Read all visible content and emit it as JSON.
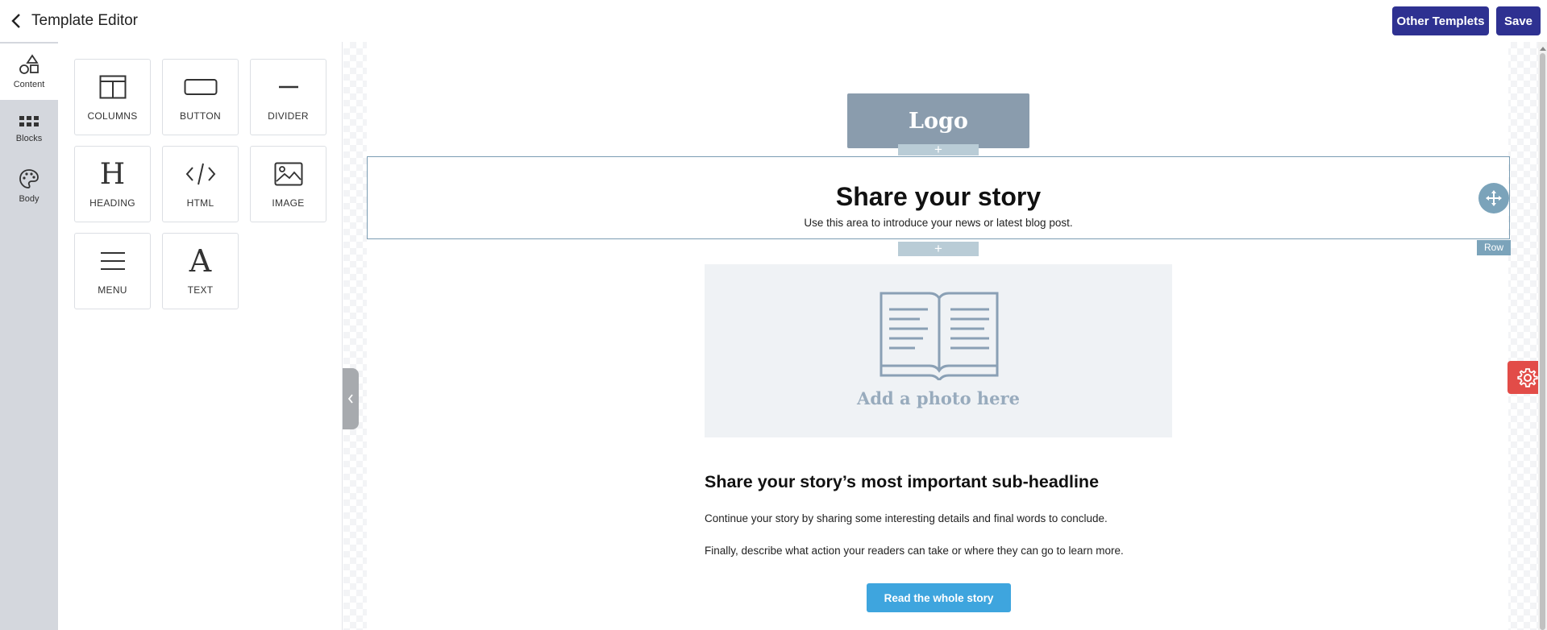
{
  "header": {
    "title": "Template Editor",
    "other_templates_label": "Other Templets",
    "save_label": "Save"
  },
  "rail": {
    "items": [
      {
        "label": "Content",
        "icon": "shapes-icon",
        "active": true
      },
      {
        "label": "Blocks",
        "icon": "grid-icon",
        "active": false
      },
      {
        "label": "Body",
        "icon": "palette-icon",
        "active": false
      }
    ]
  },
  "palette": {
    "tiles": [
      {
        "label": "COLUMNS",
        "icon": "columns-icon"
      },
      {
        "label": "BUTTON",
        "icon": "button-icon"
      },
      {
        "label": "DIVIDER",
        "icon": "divider-icon"
      },
      {
        "label": "HEADING",
        "icon": "heading-icon",
        "glyph": "H"
      },
      {
        "label": "HTML",
        "icon": "code-icon",
        "glyph": "</>"
      },
      {
        "label": "IMAGE",
        "icon": "image-icon"
      },
      {
        "label": "MENU",
        "icon": "menu-icon"
      },
      {
        "label": "TEXT",
        "icon": "text-icon",
        "glyph": "A"
      }
    ]
  },
  "email": {
    "logo_text": "Logo",
    "plus_glyph": "+",
    "headline": "Share your story",
    "intro": "Use this area to introduce your news or latest blog post.",
    "row_tag": "Row",
    "photo_caption": "Add a photo here",
    "subheadline": "Share your story’s most important sub-headline",
    "paragraph_1": "Continue your story by sharing some interesting details and final words to conclude.",
    "paragraph_2": "Finally, describe what action your readers can take or where they can go to learn more.",
    "cta_label": "Read the whole story"
  },
  "colors": {
    "primary": "#2e3191",
    "cta": "#3ea5de",
    "logo_bg": "#8a9cad",
    "selection": "#7ba3ba",
    "settings_fab": "#e24c48"
  }
}
